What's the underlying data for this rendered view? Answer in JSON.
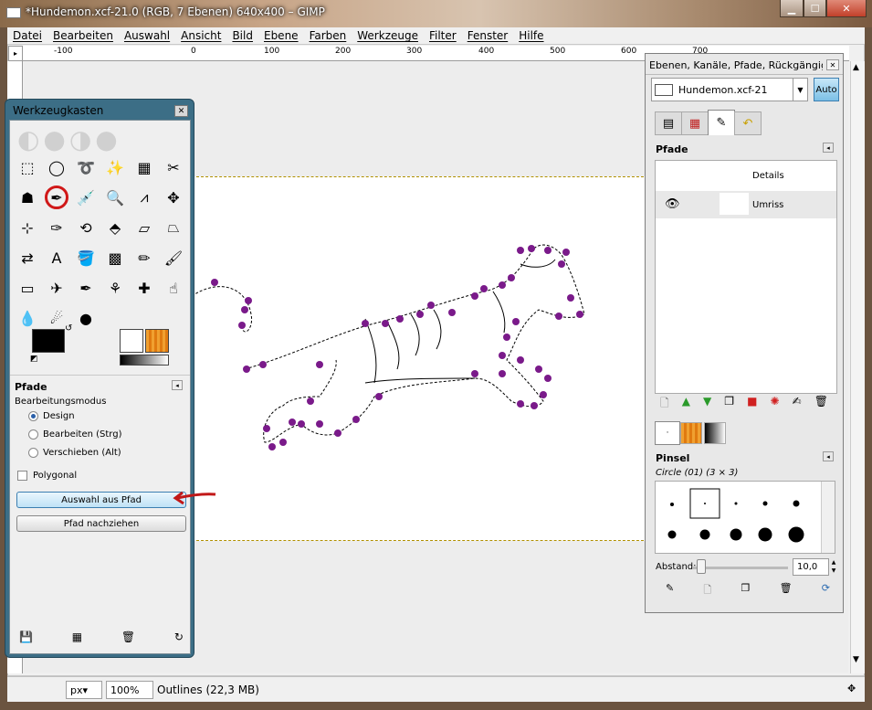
{
  "window": {
    "title": "*Hundemon.xcf-21.0 (RGB, 7 Ebenen) 640x400 – GIMP",
    "min_label": "▁",
    "max_label": "☐",
    "close_label": "✕"
  },
  "menu": [
    "Datei",
    "Bearbeiten",
    "Auswahl",
    "Ansicht",
    "Bild",
    "Ebene",
    "Farben",
    "Werkzeuge",
    "Filter",
    "Fenster",
    "Hilfe"
  ],
  "ruler": {
    "labels": [
      "-100",
      "0",
      "100",
      "200",
      "300",
      "400",
      "500",
      "600",
      "700"
    ]
  },
  "status": {
    "unit": "px▾",
    "zoom": "100%",
    "info": "Outlines (22,3 MB)"
  },
  "toolbox": {
    "title": "Werkzeugkasten",
    "tools": [
      "rect-select-icon",
      "ellipse-select-icon",
      "free-select-icon",
      "fuzzy-select-icon",
      "color-select-icon",
      "scissors-icon",
      "foreground-select-icon",
      "paths-tool-icon",
      "color-picker-icon",
      "zoom-icon",
      "measure-icon",
      "move-icon",
      "align-icon",
      "crop-icon",
      "rotate-icon",
      "scale-icon",
      "shear-icon",
      "perspective-icon",
      "flip-icon",
      "text-icon",
      "bucket-fill-icon",
      "blend-icon",
      "pencil-icon",
      "paintbrush-icon",
      "eraser-icon",
      "airbrush-icon",
      "ink-icon",
      "clone-icon",
      "heal-icon",
      "smudge-icon",
      "blur-icon",
      "dodge-icon",
      "burn-icon"
    ],
    "options_title": "Pfade",
    "mode_label": "Bearbeitungsmodus",
    "modes": [
      "Design",
      "Bearbeiten (Strg)",
      "Verschieben (Alt)"
    ],
    "polygonal": "Polygonal",
    "btn_selection": "Auswahl aus Pfad",
    "btn_stroke": "Pfad nachziehen"
  },
  "dock": {
    "title": "Ebenen, Kanäle, Pfade, Rückgängig",
    "image_select": "Hundemon.xcf-21",
    "auto": "Auto",
    "paths_title": "Pfade",
    "paths": [
      {
        "name": "Details"
      },
      {
        "name": "Umriss"
      }
    ],
    "brushes_title": "Pinsel",
    "brush_name": "Circle (01) (3 × 3)",
    "spacing_label": "Abstand:",
    "spacing_value": "10,0"
  }
}
